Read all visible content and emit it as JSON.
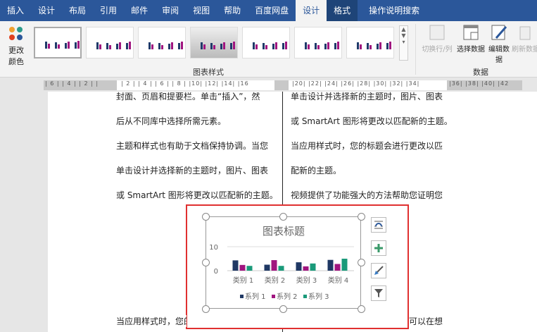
{
  "tabs": [
    "插入",
    "设计",
    "布局",
    "引用",
    "邮件",
    "审阅",
    "视图",
    "帮助",
    "百度网盘",
    "设计",
    "格式",
    "操作说明搜索"
  ],
  "ribbon": {
    "change_colors": "更改颜色",
    "styles_group": "图表样式",
    "data_group": "数据",
    "switch_row_col": "切换行/列",
    "select_data": "选择数据",
    "edit_data": "编辑数据",
    "refresh_data": "刷新数据"
  },
  "ruler": {
    "left": "| 6 |  | 4 |  | 2 |  |",
    "main": "| 2 |  | 4 |  | 6 |  | 8 |  |10|  |12|  |14|  |16",
    "right": "|20|  |22|  |24|  |26|  |28|  |30|  |32|  |34|",
    "far": "|36|  |38|  |40|  |42"
  },
  "doc": {
    "left": [
      "封面、页眉和提要栏。单击“插入”，然",
      "后从不同库中选择所需元素。",
      "主题和样式也有助于文档保持协调。当您",
      "单击设计并选择新的主题时，图片、图表",
      "或 SmartArt 图形将更改以匹配新的主题。"
    ],
    "right": [
      "单击设计并选择新的主题时，图片、图表",
      "或 SmartArt 图形将更改以匹配新的主题。",
      "当应用样式时，您的标题会进行更改以匹",
      "配新的主题。",
      "视频提供了功能强大的方法帮助您证明您"
    ],
    "left_bottom": "当应用样式时，您的标题会进行更改以匹",
    "right_bottom": "的观点。当您单击联机视频时，可以在想"
  },
  "chart_data": {
    "type": "bar",
    "title": "图表标题",
    "categories": [
      "类别 1",
      "类别 2",
      "类别 3",
      "类别 4"
    ],
    "series": [
      {
        "name": "系列 1",
        "values": [
          4.3,
          2.5,
          3.5,
          4.5
        ],
        "color": "#1f3864"
      },
      {
        "name": "系列 2",
        "values": [
          2.4,
          4.4,
          1.8,
          2.8
        ],
        "color": "#a0157f"
      },
      {
        "name": "系列 3",
        "values": [
          2,
          2,
          3,
          5
        ],
        "color": "#1a9a7a"
      }
    ],
    "ylim": [
      0,
      10
    ],
    "yticks": [
      "0",
      "10"
    ],
    "legend": "bottom"
  }
}
